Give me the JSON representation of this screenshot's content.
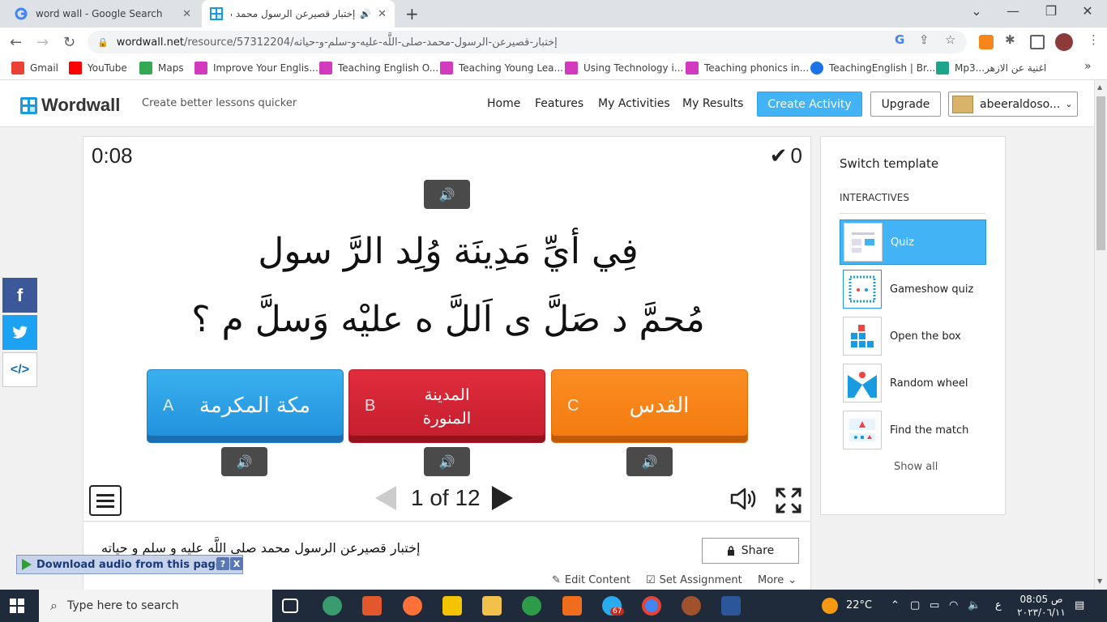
{
  "browser": {
    "tabs": [
      {
        "title": "word wall - Google Search",
        "close": "✕"
      },
      {
        "title": "إختبار قصيرعن الرسول محمد ص",
        "close": "✕"
      }
    ],
    "new_tab": "+",
    "window": {
      "minimize": "⌄",
      "restore": "—",
      "max": "❐",
      "close": "✕"
    },
    "url_host": "wordwall.net",
    "url_path": "/resource/57312204/إختبار-قصيرعن-الرسول-محمد-صلى-اللَّه-عليه-و-سلم-و-حياته",
    "bookmarks": [
      {
        "label": "Gmail",
        "color": "#ea4335"
      },
      {
        "label": "YouTube",
        "color": "#ff0000"
      },
      {
        "label": "Maps",
        "color": "#34a853"
      },
      {
        "label": "Improve Your Englis...",
        "color": "#d23bbd"
      },
      {
        "label": "Teaching English O...",
        "color": "#d23bbd"
      },
      {
        "label": "Teaching Young Lea...",
        "color": "#d23bbd"
      },
      {
        "label": "Using Technology i...",
        "color": "#d23bbd"
      },
      {
        "label": "Teaching phonics in...",
        "color": "#d23bbd"
      },
      {
        "label": "TeachingEnglish | Br...",
        "color": "#1a73e8"
      },
      {
        "label": "Mp3...اغنية عن الازهر",
        "color": "#1ba58a"
      }
    ],
    "more_bookmarks": "»"
  },
  "header": {
    "logo": "Wordwall",
    "tagline": "Create better lessons quicker",
    "nav": [
      "Home",
      "Features",
      "My Activities",
      "My Results"
    ],
    "create_label": "Create Activity",
    "upgrade_label": "Upgrade",
    "user_name": "abeeraldoso..."
  },
  "game": {
    "timer": "0:08",
    "score": "0",
    "question_line1": "فِي أيِّ  مَدِينَة وُلِد الرَّ سول",
    "question_line2": "مُحمَّ د صَلَّ ى اَللَّ ه عليْه وَسلَّ م ؟",
    "answers": [
      {
        "letter": "A",
        "text": "مكة المكرمة",
        "color": "#2a9fe6"
      },
      {
        "letter": "B",
        "text": "المدينة المنورة",
        "color": "#d42534"
      },
      {
        "letter": "C",
        "text": "القدس",
        "color": "#f5821a"
      }
    ],
    "page_current": "1",
    "page_total": "12",
    "page_text": "1 of 12"
  },
  "info": {
    "title": "إختبار قصيرعن الرسول محمد صلى اللَّه عليه و سلم و حياته",
    "share_label": "Share",
    "edit_label": "Edit Content",
    "assign_label": "Set Assignment",
    "more_label": "More"
  },
  "sidebar": {
    "title": "Switch template",
    "section": "INTERACTIVES",
    "templates": [
      "Quiz",
      "Gameshow quiz",
      "Open the box",
      "Random wheel",
      "Find the match"
    ],
    "selected": "Quiz",
    "show_all": "Show all"
  },
  "download_bar": {
    "label": "Download audio from this page",
    "help": "?",
    "close": "X"
  },
  "taskbar": {
    "search_placeholder": "Type here to search",
    "weather": "22°C",
    "lang": "ع",
    "time": "08:05 ص",
    "date": "٢٠٢٣/٠٦/١١",
    "badge": "67"
  }
}
